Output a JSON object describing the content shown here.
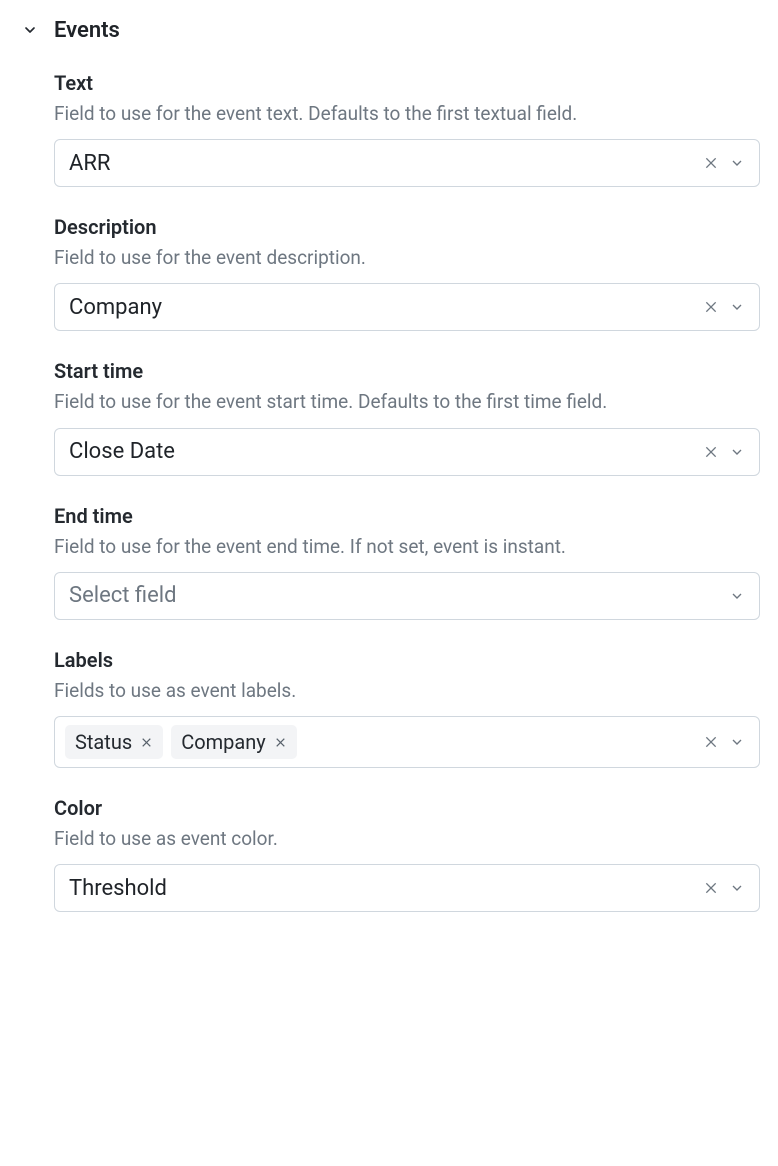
{
  "section": {
    "title": "Events",
    "fields": {
      "text": {
        "label": "Text",
        "help": "Field to use for the event text. Defaults to the first textual field.",
        "value": "ARR",
        "hasClear": true
      },
      "description": {
        "label": "Description",
        "help": "Field to use for the event description.",
        "value": "Company",
        "hasClear": true
      },
      "start_time": {
        "label": "Start time",
        "help": "Field to use for the event start time. Defaults to the first time field.",
        "value": "Close Date",
        "hasClear": true
      },
      "end_time": {
        "label": "End time",
        "help": "Field to use for the event end time. If not set, event is instant.",
        "placeholder": "Select field",
        "hasClear": false
      },
      "labels": {
        "label": "Labels",
        "help": "Fields to use as event labels.",
        "tags": [
          "Status",
          "Company"
        ],
        "hasClear": true
      },
      "color": {
        "label": "Color",
        "help": "Field to use as event color.",
        "value": "Threshold",
        "hasClear": true
      }
    }
  }
}
